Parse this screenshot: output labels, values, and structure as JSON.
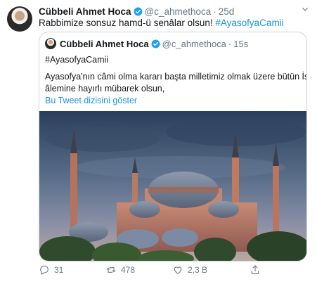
{
  "tweet": {
    "name": "Cübbeli Ahmet Hoca",
    "handle": "@c_ahmethoca",
    "dot": "·",
    "time": "25d",
    "text_plain": "Rabbimize sonsuz hamd-ü senâlar olsun! ",
    "text_hashtag": "#AyasofyaCamii"
  },
  "quoted": {
    "name": "Cübbeli Ahmet Hoca",
    "handle": "@c_ahmethoca",
    "dot": "·",
    "time": "15s",
    "hashtag": "#AyasofyaCamii",
    "line1": "Ayasofya'nın câmi olma kararı başta milletimiz olmak üzere bütün İslam",
    "line2": "âlemine hayırlı mübarek olsun,",
    "thread_link": "Bu Tweet dizisini göster"
  },
  "actions": {
    "reply_count": "31",
    "retweet_count": "478",
    "like_count": "2,3 B"
  },
  "colors": {
    "link": "#1b95e0",
    "muted": "#657786",
    "border": "#ccd6dd",
    "verified": "#1da1f2"
  },
  "icons": [
    "verified-badge-icon",
    "more-icon",
    "reply-icon",
    "retweet-icon",
    "like-icon",
    "share-icon"
  ]
}
